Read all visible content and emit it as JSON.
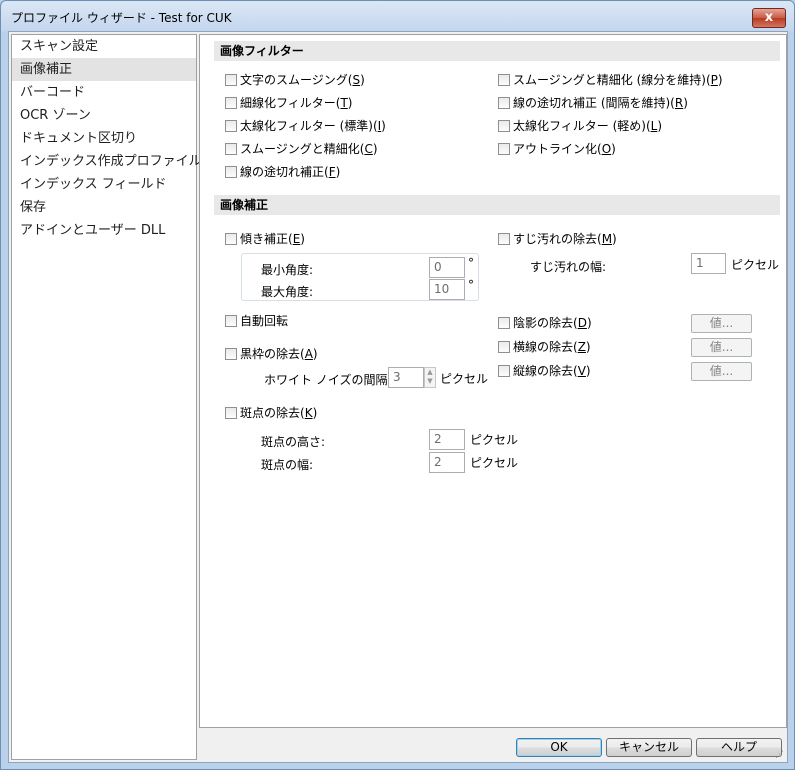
{
  "window": {
    "title": "プロファイル ウィザード - Test for CUK",
    "close_glyph": "x"
  },
  "sidebar": {
    "items": [
      {
        "label": "スキャン設定"
      },
      {
        "label": "画像補正"
      },
      {
        "label": "バーコード"
      },
      {
        "label": "OCR ゾーン"
      },
      {
        "label": "ドキュメント区切り"
      },
      {
        "label": "インデックス作成プロファイル"
      },
      {
        "label": "インデックス フィールド"
      },
      {
        "label": "保存"
      },
      {
        "label": "アドインとユーザー DLL"
      }
    ],
    "selected_index": 1
  },
  "filters": {
    "header": "画像フィルター",
    "left": [
      {
        "label": "文字のスムージング(",
        "key": "S",
        "tail": ")"
      },
      {
        "label": "細線化フィルター(",
        "key": "T",
        "tail": ")"
      },
      {
        "label": "太線化フィルター (標準)(",
        "key": "I",
        "tail": ")"
      },
      {
        "label": "スムージングと精細化(",
        "key": "C",
        "tail": ")"
      },
      {
        "label": "線の途切れ補正(",
        "key": "F",
        "tail": ")"
      }
    ],
    "right": [
      {
        "label": "スムージングと精細化 (線分を維持)(",
        "key": "P",
        "tail": ")"
      },
      {
        "label": "線の途切れ補正 (間隔を維持)(",
        "key": "R",
        "tail": ")"
      },
      {
        "label": "太線化フィルター (軽め)(",
        "key": "L",
        "tail": ")"
      },
      {
        "label": "アウトライン化(",
        "key": "O",
        "tail": ")"
      }
    ]
  },
  "correction": {
    "header": "画像補正",
    "deskew": {
      "label": "傾き補正(",
      "key": "E",
      "tail": ")",
      "min_label": "最小角度:",
      "min_value": "0",
      "max_label": "最大角度:",
      "max_value": "10",
      "unit": "°"
    },
    "auto_rotate": {
      "label": "自動回転"
    },
    "border_removal": {
      "label": "黒枠の除去(",
      "key": "A",
      "tail": ")",
      "noise_label": "ホワイト ノイズの間隔:",
      "noise_value": "3",
      "unit": "ピクセル"
    },
    "despeckle": {
      "label": "斑点の除去(",
      "key": "K",
      "tail": ")",
      "height_label": "斑点の高さ:",
      "height_value": "2",
      "width_label": "斑点の幅:",
      "width_value": "2",
      "unit": "ピクセル"
    },
    "streak": {
      "label": "すじ汚れの除去(",
      "key": "M",
      "tail": ")",
      "width_label": "すじ汚れの幅:",
      "width_value": "1",
      "unit": "ピクセル"
    },
    "shade": {
      "label": "陰影の除去(",
      "key": "D",
      "tail": ")"
    },
    "hline": {
      "label": "横線の除去(",
      "key": "Z",
      "tail": ")"
    },
    "vline": {
      "label": "縦線の除去(",
      "key": "V",
      "tail": ")"
    },
    "value_button": "値..."
  },
  "footer": {
    "ok": "OK",
    "cancel": "キャンセル",
    "help": "ヘルプ"
  }
}
